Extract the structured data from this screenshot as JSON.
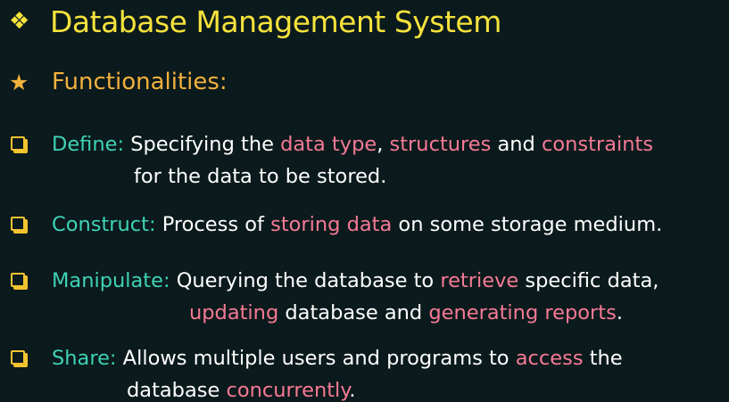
{
  "title": {
    "icon": "❖",
    "text": "Database Management System"
  },
  "subtitle": {
    "icon": "★",
    "text": "Functionalities:"
  },
  "items": {
    "define": {
      "label": "Define:",
      "l1_a": "Specifying the ",
      "l1_b": "data type",
      "l1_c": ", ",
      "l1_d": "structures",
      "l1_e": " and ",
      "l1_f": "constraints",
      "l2": "for the data to be stored."
    },
    "construct": {
      "label": "Construct:",
      "l1_a": "Process of ",
      "l1_b": "storing data",
      "l1_c": " on some storage medium."
    },
    "manipulate": {
      "label": "Manipulate:",
      "l1_a": "Querying the database to ",
      "l1_b": "retrieve",
      "l1_c": " specific data,",
      "l2_a": "updating",
      "l2_b": " database and ",
      "l2_c": "generating reports",
      "l2_d": "."
    },
    "share": {
      "label": "Share:",
      "l1_a": "Allows multiple users and programs to ",
      "l1_b": "access",
      "l1_c": " the",
      "l2_a": "database ",
      "l2_b": "concurrently",
      "l2_c": "."
    }
  },
  "colors": {
    "background": "#0b1a1c",
    "title": "#f6e23c",
    "subtitle": "#f3b13d",
    "label": "#3ed3b5",
    "highlight": "#f67a95",
    "bullet": "#f4c430"
  }
}
